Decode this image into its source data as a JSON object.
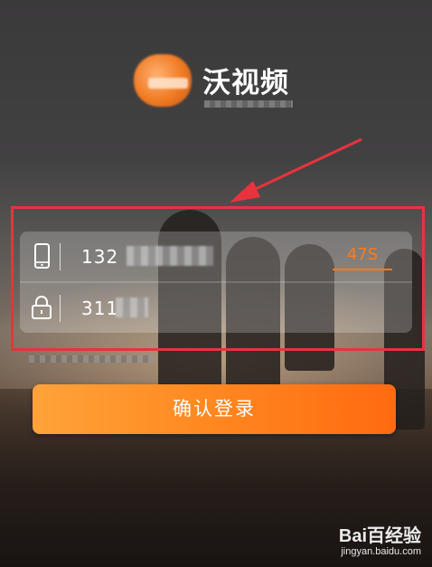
{
  "header": {
    "brand_name": "沃视频",
    "logo_icon": "wo-video-logo-icon"
  },
  "annotation": {
    "highlight_color": "#e8333c"
  },
  "login_form": {
    "phone": {
      "icon": "phone-icon",
      "value": "132",
      "countdown_label": "47S"
    },
    "code": {
      "icon": "lock-icon",
      "value": "311"
    },
    "confirm_label": "确认登录"
  },
  "watermark": {
    "logo_text": "Bai百经验",
    "url": "jingyan.baidu.com"
  },
  "colors": {
    "accent": "#ff7a1a",
    "button_start": "#ffa33a",
    "button_end": "#ff6a10"
  }
}
